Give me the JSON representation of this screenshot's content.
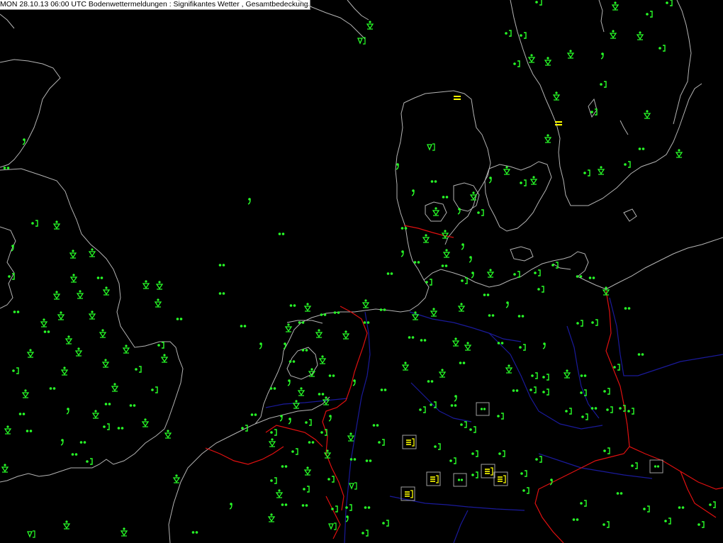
{
  "title": "MON 28.10.13 06:00 UTC  Bodenwettermeldungen :  Signifikantes Wetter , Gesamtbedeckung",
  "colors": {
    "background": "#000000",
    "coastline": "#b4b4b4",
    "border": "#e01010",
    "river": "#1a1a9a",
    "station_symbol": "#28ff28",
    "highlight_symbol": "#ffff00",
    "station_box": "#a0a0a0"
  },
  "legend_symbols": {
    "dot_bracket": "rain-shower-symbol",
    "triangle_dot": "shower-symbol",
    "double_dot": "drizzle-symbol",
    "trefoil": "rain-showers-symbol",
    "comma": "drizzle-comma-symbol",
    "stripes": "fog-symbol",
    "bracket_box": "thunderstorm-symbol"
  }
}
